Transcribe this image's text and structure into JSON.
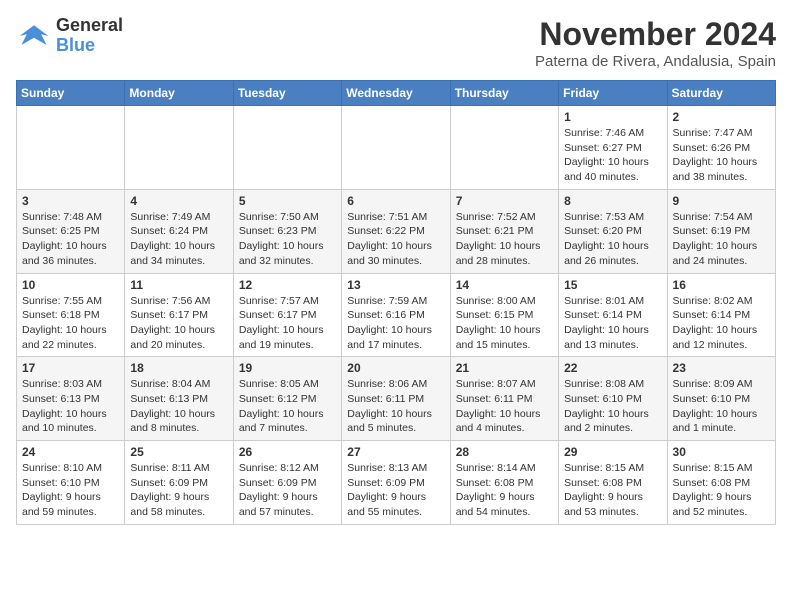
{
  "logo": {
    "line1": "General",
    "line2": "Blue"
  },
  "title": "November 2024",
  "location": "Paterna de Rivera, Andalusia, Spain",
  "days_of_week": [
    "Sunday",
    "Monday",
    "Tuesday",
    "Wednesday",
    "Thursday",
    "Friday",
    "Saturday"
  ],
  "weeks": [
    [
      {
        "day": null,
        "info": null
      },
      {
        "day": null,
        "info": null
      },
      {
        "day": null,
        "info": null
      },
      {
        "day": null,
        "info": null
      },
      {
        "day": null,
        "info": null
      },
      {
        "day": "1",
        "info": "Sunrise: 7:46 AM\nSunset: 6:27 PM\nDaylight: 10 hours and 40 minutes."
      },
      {
        "day": "2",
        "info": "Sunrise: 7:47 AM\nSunset: 6:26 PM\nDaylight: 10 hours and 38 minutes."
      }
    ],
    [
      {
        "day": "3",
        "info": "Sunrise: 7:48 AM\nSunset: 6:25 PM\nDaylight: 10 hours and 36 minutes."
      },
      {
        "day": "4",
        "info": "Sunrise: 7:49 AM\nSunset: 6:24 PM\nDaylight: 10 hours and 34 minutes."
      },
      {
        "day": "5",
        "info": "Sunrise: 7:50 AM\nSunset: 6:23 PM\nDaylight: 10 hours and 32 minutes."
      },
      {
        "day": "6",
        "info": "Sunrise: 7:51 AM\nSunset: 6:22 PM\nDaylight: 10 hours and 30 minutes."
      },
      {
        "day": "7",
        "info": "Sunrise: 7:52 AM\nSunset: 6:21 PM\nDaylight: 10 hours and 28 minutes."
      },
      {
        "day": "8",
        "info": "Sunrise: 7:53 AM\nSunset: 6:20 PM\nDaylight: 10 hours and 26 minutes."
      },
      {
        "day": "9",
        "info": "Sunrise: 7:54 AM\nSunset: 6:19 PM\nDaylight: 10 hours and 24 minutes."
      }
    ],
    [
      {
        "day": "10",
        "info": "Sunrise: 7:55 AM\nSunset: 6:18 PM\nDaylight: 10 hours and 22 minutes."
      },
      {
        "day": "11",
        "info": "Sunrise: 7:56 AM\nSunset: 6:17 PM\nDaylight: 10 hours and 20 minutes."
      },
      {
        "day": "12",
        "info": "Sunrise: 7:57 AM\nSunset: 6:17 PM\nDaylight: 10 hours and 19 minutes."
      },
      {
        "day": "13",
        "info": "Sunrise: 7:59 AM\nSunset: 6:16 PM\nDaylight: 10 hours and 17 minutes."
      },
      {
        "day": "14",
        "info": "Sunrise: 8:00 AM\nSunset: 6:15 PM\nDaylight: 10 hours and 15 minutes."
      },
      {
        "day": "15",
        "info": "Sunrise: 8:01 AM\nSunset: 6:14 PM\nDaylight: 10 hours and 13 minutes."
      },
      {
        "day": "16",
        "info": "Sunrise: 8:02 AM\nSunset: 6:14 PM\nDaylight: 10 hours and 12 minutes."
      }
    ],
    [
      {
        "day": "17",
        "info": "Sunrise: 8:03 AM\nSunset: 6:13 PM\nDaylight: 10 hours and 10 minutes."
      },
      {
        "day": "18",
        "info": "Sunrise: 8:04 AM\nSunset: 6:13 PM\nDaylight: 10 hours and 8 minutes."
      },
      {
        "day": "19",
        "info": "Sunrise: 8:05 AM\nSunset: 6:12 PM\nDaylight: 10 hours and 7 minutes."
      },
      {
        "day": "20",
        "info": "Sunrise: 8:06 AM\nSunset: 6:11 PM\nDaylight: 10 hours and 5 minutes."
      },
      {
        "day": "21",
        "info": "Sunrise: 8:07 AM\nSunset: 6:11 PM\nDaylight: 10 hours and 4 minutes."
      },
      {
        "day": "22",
        "info": "Sunrise: 8:08 AM\nSunset: 6:10 PM\nDaylight: 10 hours and 2 minutes."
      },
      {
        "day": "23",
        "info": "Sunrise: 8:09 AM\nSunset: 6:10 PM\nDaylight: 10 hours and 1 minute."
      }
    ],
    [
      {
        "day": "24",
        "info": "Sunrise: 8:10 AM\nSunset: 6:10 PM\nDaylight: 9 hours and 59 minutes."
      },
      {
        "day": "25",
        "info": "Sunrise: 8:11 AM\nSunset: 6:09 PM\nDaylight: 9 hours and 58 minutes."
      },
      {
        "day": "26",
        "info": "Sunrise: 8:12 AM\nSunset: 6:09 PM\nDaylight: 9 hours and 57 minutes."
      },
      {
        "day": "27",
        "info": "Sunrise: 8:13 AM\nSunset: 6:09 PM\nDaylight: 9 hours and 55 minutes."
      },
      {
        "day": "28",
        "info": "Sunrise: 8:14 AM\nSunset: 6:08 PM\nDaylight: 9 hours and 54 minutes."
      },
      {
        "day": "29",
        "info": "Sunrise: 8:15 AM\nSunset: 6:08 PM\nDaylight: 9 hours and 53 minutes."
      },
      {
        "day": "30",
        "info": "Sunrise: 8:15 AM\nSunset: 6:08 PM\nDaylight: 9 hours and 52 minutes."
      }
    ]
  ]
}
